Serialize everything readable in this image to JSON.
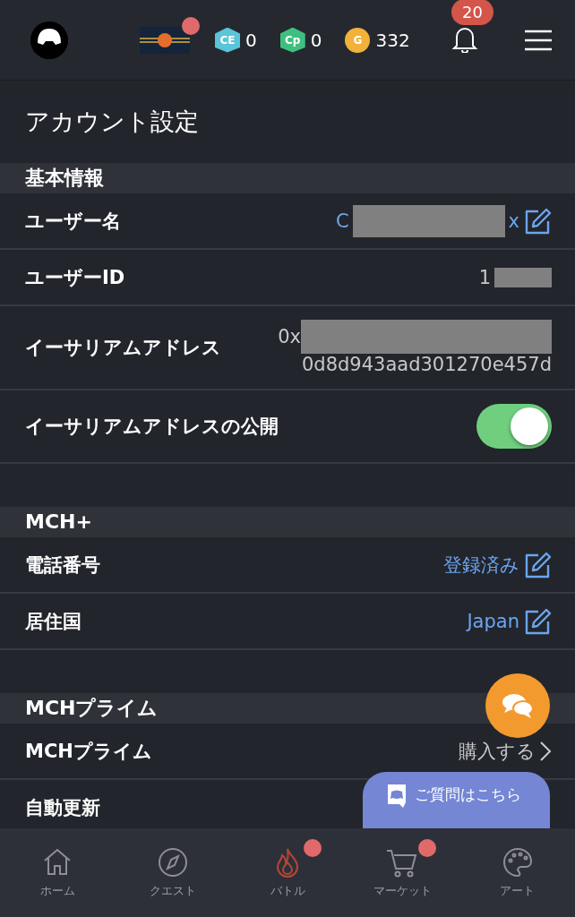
{
  "header": {
    "banner_dot": true,
    "currencies": [
      {
        "kind": "ce",
        "icon_label": "CE",
        "amount": "0"
      },
      {
        "kind": "cp",
        "icon_label": "Cp",
        "amount": "0"
      },
      {
        "kind": "gold",
        "icon_label": "G",
        "amount": "332"
      }
    ],
    "notification_count": "20"
  },
  "title": "アカウント設定",
  "sections": [
    {
      "heading": "基本情報",
      "rows": [
        {
          "kind": "edit",
          "label": "ユーザー名",
          "value_start": "C",
          "value_end": "x",
          "redacted": true
        },
        {
          "kind": "text",
          "label": "ユーザーID",
          "value_start": "1",
          "redacted": true
        },
        {
          "kind": "address",
          "label": "イーサリアムアドレス",
          "lines": [
            "0x",
            "0d8d943aad301270e457d"
          ],
          "redacted": true
        },
        {
          "kind": "toggle",
          "label": "イーサリアムアドレスの公開",
          "on": true
        }
      ]
    },
    {
      "heading": "MCH+",
      "rows": [
        {
          "kind": "edit",
          "label": "電話番号",
          "value_start": "登録済み"
        },
        {
          "kind": "edit",
          "label": "居住国",
          "value_start": "Japan"
        }
      ]
    },
    {
      "heading": "MCHプライム",
      "rows": [
        {
          "kind": "link",
          "label": "MCHプライム",
          "value_start": "購入する"
        },
        {
          "kind": "text",
          "label": "自動更新"
        }
      ]
    }
  ],
  "help_button": "ご質問はこちら",
  "nav": [
    {
      "kind": "home",
      "label": "ホーム",
      "selected": false,
      "dot": false
    },
    {
      "kind": "compass",
      "label": "クエスト",
      "selected": false,
      "dot": false
    },
    {
      "kind": "flame",
      "label": "バトル",
      "selected": true,
      "dot": true
    },
    {
      "kind": "cart",
      "label": "マーケット",
      "selected": false,
      "dot": true
    },
    {
      "kind": "palette",
      "label": "アート",
      "selected": false,
      "dot": false
    }
  ]
}
